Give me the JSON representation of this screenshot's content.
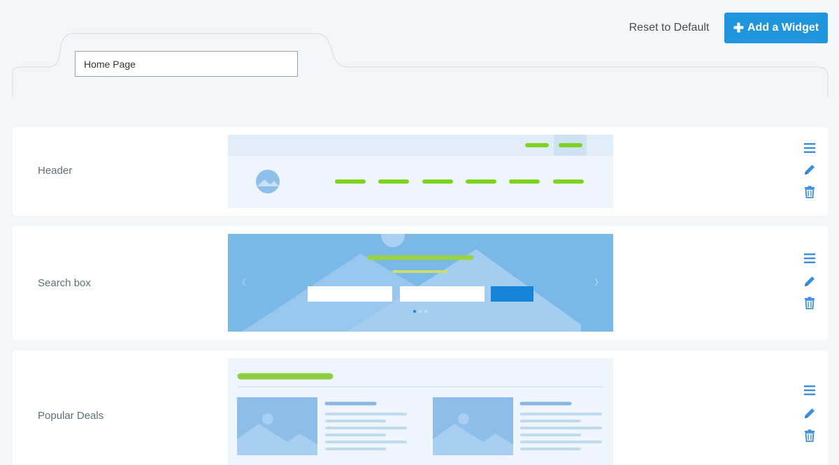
{
  "toolbar": {
    "reset_label": "Reset to Default",
    "add_label": "Add a Widget",
    "add_icon": "plus-icon"
  },
  "page": {
    "name_value": "Home Page",
    "name_placeholder": ""
  },
  "widgets": [
    {
      "label": "Header",
      "preview": "header-preview"
    },
    {
      "label": "Search box",
      "preview": "search-box-preview"
    },
    {
      "label": "Popular Deals",
      "preview": "popular-deals-preview"
    }
  ],
  "row_actions": [
    "reorder-icon",
    "edit-icon",
    "delete-icon"
  ],
  "colors": {
    "accent": "#1e95dc",
    "icon_blue": "#3b8ede",
    "preview_green": "#7ed321",
    "preview_blue": "#7ab8e8",
    "label": "#5b6f78"
  }
}
